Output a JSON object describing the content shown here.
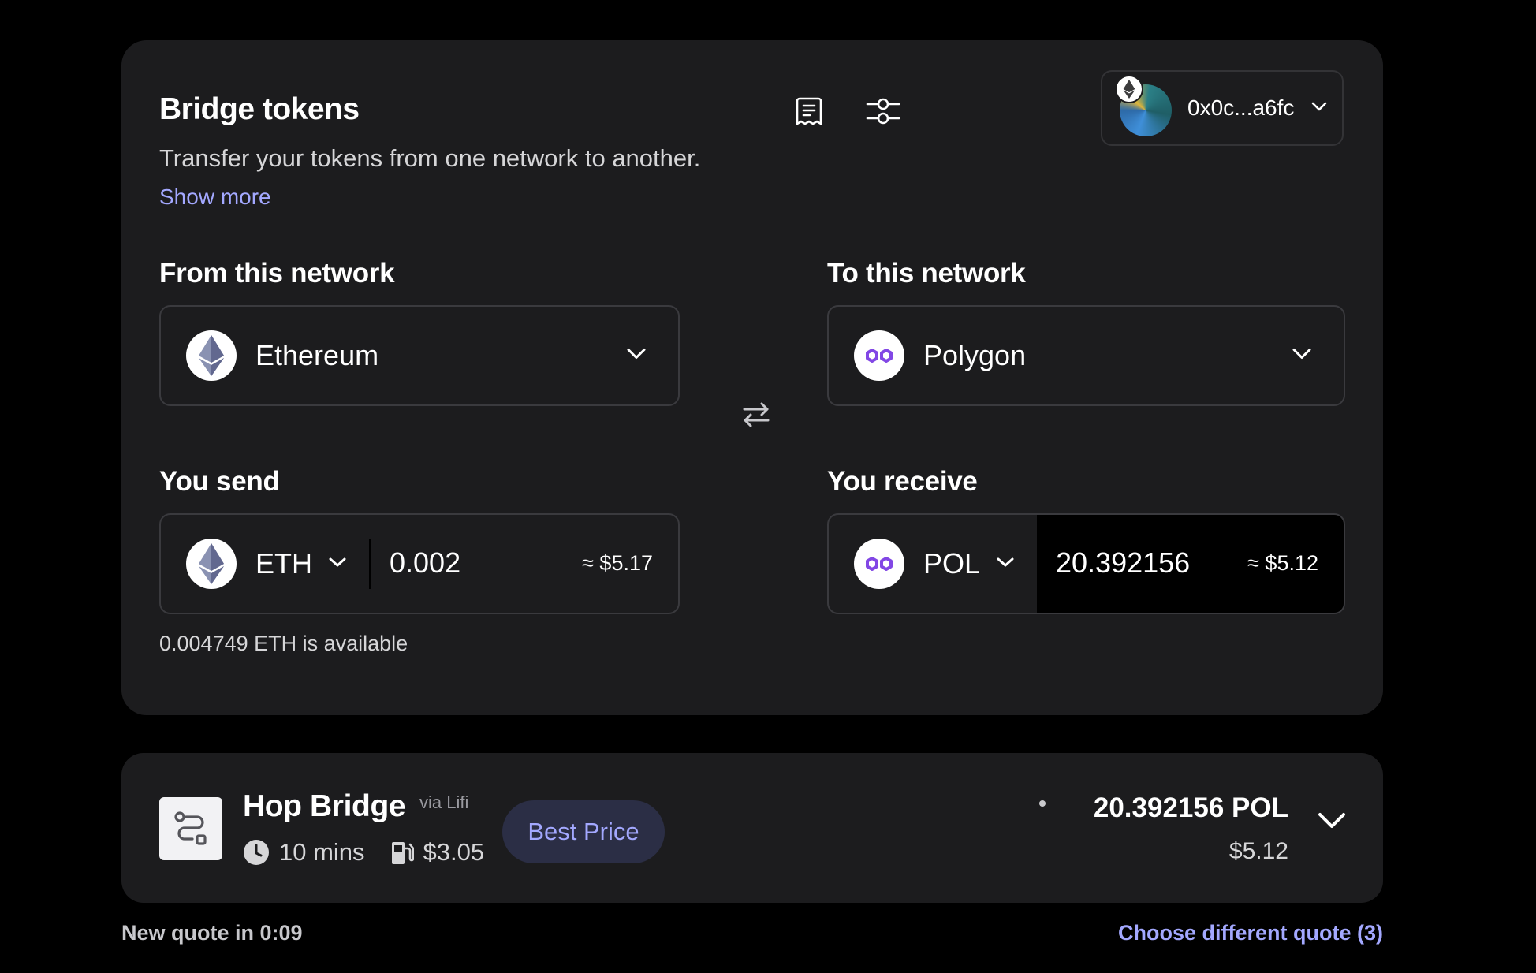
{
  "header": {
    "title": "Bridge tokens",
    "subtitle": "Transfer your tokens from one network to another.",
    "show_more": "Show more",
    "account": "0x0c...a6fc"
  },
  "from": {
    "label": "From this network",
    "network": "Ethereum"
  },
  "to": {
    "label": "To this network",
    "network": "Polygon"
  },
  "send": {
    "label": "You send",
    "token": "ETH",
    "amount": "0.002",
    "usd": "≈ $5.17",
    "available": "0.004749 ETH is available"
  },
  "receive": {
    "label": "You receive",
    "token": "POL",
    "amount": "20.392156",
    "usd": "≈ $5.12"
  },
  "quote": {
    "bridge_name": "Hop Bridge",
    "via": "via Lifi",
    "time": "10 mins",
    "fee": "$3.05",
    "badge": "Best Price",
    "amount": "20.392156 POL",
    "usd": "$5.12"
  },
  "footer": {
    "new_quote": "New quote in 0:09",
    "choose_quote": "Choose different quote (3)"
  },
  "colors": {
    "background": "#000000",
    "card": "#1c1c1e",
    "accent": "#a3a8ff",
    "polygon": "#8247e5"
  },
  "icons": [
    "receipt-icon",
    "settings-sliders-icon",
    "ethereum-icon",
    "polygon-icon",
    "swap-arrows-icon",
    "chevron-down-icon",
    "route-icon",
    "clock-icon",
    "gas-pump-icon"
  ]
}
